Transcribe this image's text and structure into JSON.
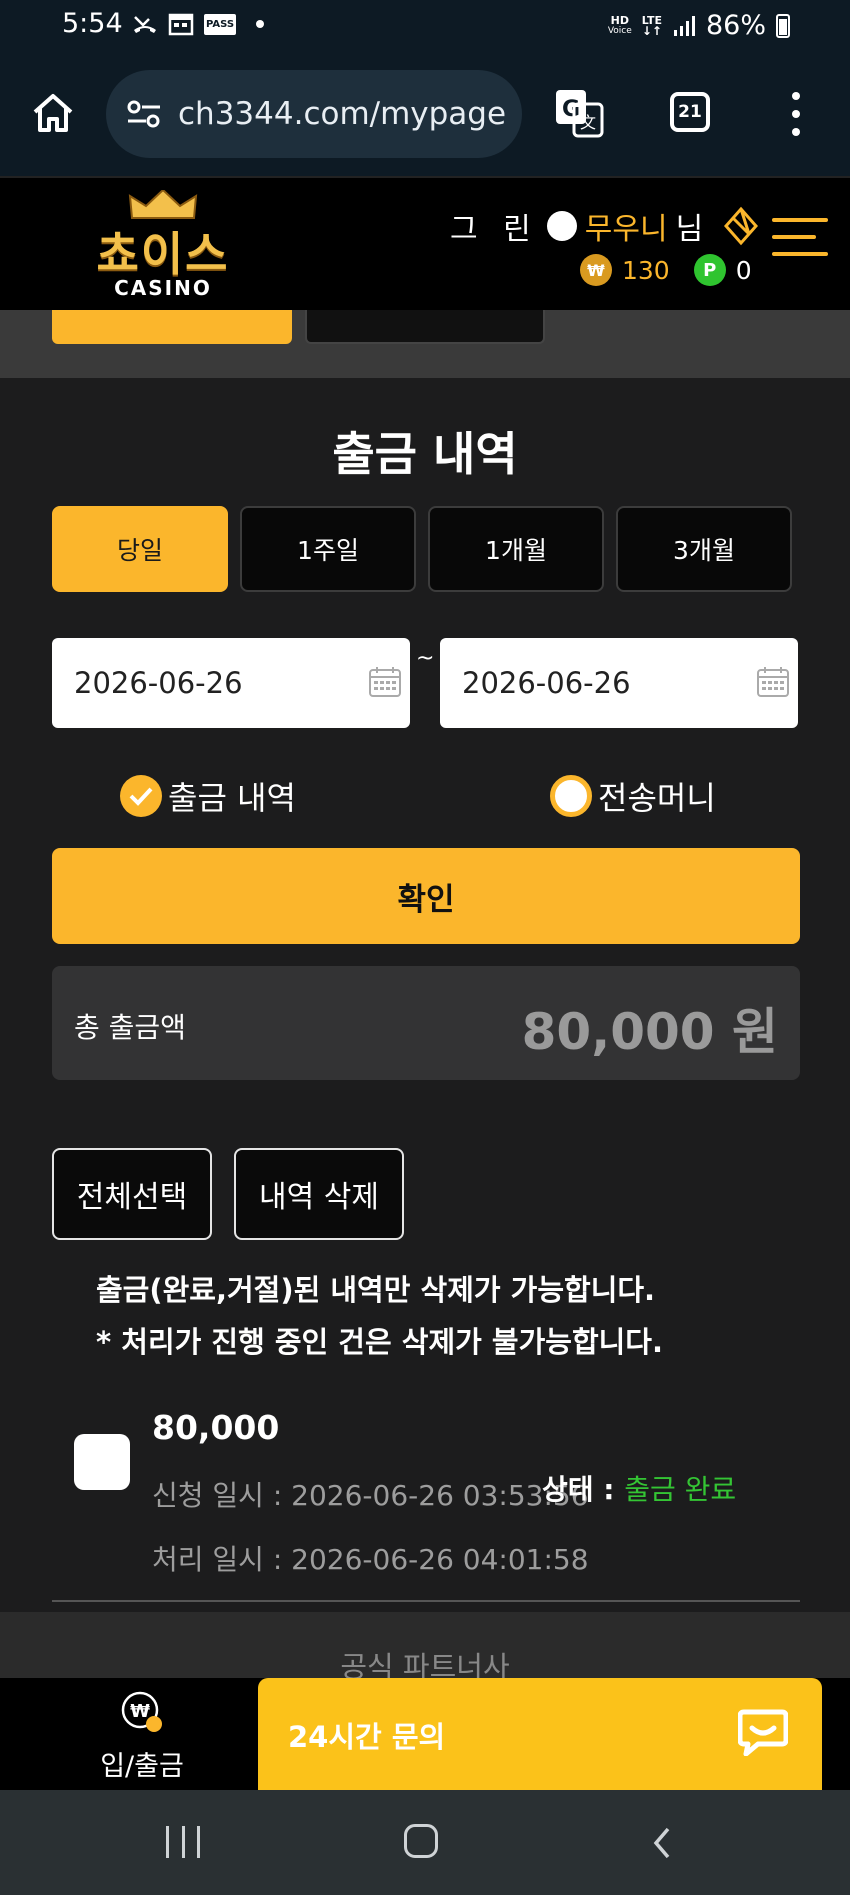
{
  "status_bar": {
    "time": "5:54",
    "pass_label": "PASS",
    "hd_label": "HD",
    "voice_label": "Voice",
    "lte_label": "LTE",
    "battery": "86%"
  },
  "browser": {
    "url": "ch3344.com/mypage",
    "tab_count": "21"
  },
  "header": {
    "logo_ko": "쵸이스",
    "logo_en": "CASINO",
    "user_prefix": "그 린",
    "user_name": "무우니",
    "user_suffix": "님",
    "won_symbol": "₩",
    "coin_balance": "130",
    "point_symbol": "P",
    "point_balance": "0"
  },
  "page": {
    "title": "출금 내역",
    "periods": [
      "당일",
      "1주일",
      "1개월",
      "3개월"
    ],
    "date_from": "2026-06-26",
    "date_separator": "~",
    "date_to": "2026-06-26",
    "radio_withdraw": "출금 내역",
    "radio_transfer": "전송머니",
    "confirm_label": "확인",
    "total_label": "총 출금액",
    "total_amount": "80,000 원",
    "select_all_label": "전체선택",
    "delete_label": "내역 삭제",
    "notice_line1": "출금(완료,거절)된 내역만 삭제가 가능합니다.",
    "notice_line2": "* 처리가 진행 중인 건은 삭제가 불가능합니다.",
    "partner_label": "공식 파트너사"
  },
  "records": [
    {
      "amount": "80,000",
      "requested": "신청 일시 : 2026-06-26 03:53:56",
      "processed": "처리 일시 : 2026-06-26 04:01:58",
      "status_label": "상태 : ",
      "status_value": "출금 완료"
    }
  ],
  "bottom_bar": {
    "deposit_label": "입/출금",
    "chat_label": "24시간 문의"
  },
  "colors": {
    "accent": "#fbb62c",
    "status_ok": "#34c534",
    "background": "#1c1c1d"
  }
}
